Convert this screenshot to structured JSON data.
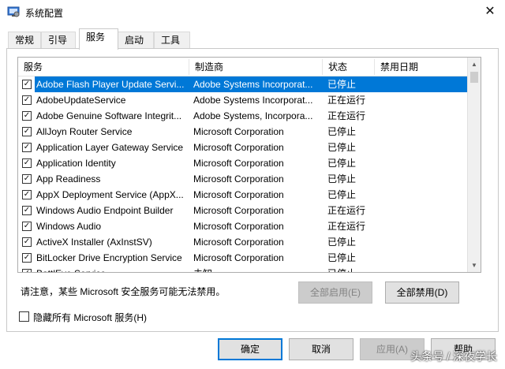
{
  "window": {
    "title": "系统配置"
  },
  "tabs": [
    {
      "label": "常规"
    },
    {
      "label": "引导"
    },
    {
      "label": "服务"
    },
    {
      "label": "启动"
    },
    {
      "label": "工具"
    }
  ],
  "list": {
    "columns": [
      "服务",
      "制造商",
      "状态",
      "禁用日期"
    ],
    "rows": [
      {
        "name": "Adobe Flash Player Update Servi...",
        "mfr": "Adobe Systems Incorporat...",
        "status": "已停止",
        "date": "",
        "checked": true,
        "selected": true
      },
      {
        "name": "AdobeUpdateService",
        "mfr": "Adobe Systems Incorporat...",
        "status": "正在运行",
        "date": "",
        "checked": true
      },
      {
        "name": "Adobe Genuine Software Integrit...",
        "mfr": "Adobe Systems, Incorpora...",
        "status": "正在运行",
        "date": "",
        "checked": true
      },
      {
        "name": "AllJoyn Router Service",
        "mfr": "Microsoft Corporation",
        "status": "已停止",
        "date": "",
        "checked": true
      },
      {
        "name": "Application Layer Gateway Service",
        "mfr": "Microsoft Corporation",
        "status": "已停止",
        "date": "",
        "checked": true
      },
      {
        "name": "Application Identity",
        "mfr": "Microsoft Corporation",
        "status": "已停止",
        "date": "",
        "checked": true
      },
      {
        "name": "App Readiness",
        "mfr": "Microsoft Corporation",
        "status": "已停止",
        "date": "",
        "checked": true
      },
      {
        "name": "AppX Deployment Service (AppX...",
        "mfr": "Microsoft Corporation",
        "status": "已停止",
        "date": "",
        "checked": true
      },
      {
        "name": "Windows Audio Endpoint Builder",
        "mfr": "Microsoft Corporation",
        "status": "正在运行",
        "date": "",
        "checked": true
      },
      {
        "name": "Windows Audio",
        "mfr": "Microsoft Corporation",
        "status": "正在运行",
        "date": "",
        "checked": true
      },
      {
        "name": "ActiveX Installer (AxInstSV)",
        "mfr": "Microsoft Corporation",
        "status": "已停止",
        "date": "",
        "checked": true
      },
      {
        "name": "BitLocker Drive Encryption Service",
        "mfr": "Microsoft Corporation",
        "status": "已停止",
        "date": "",
        "checked": true
      },
      {
        "name": "BattlEye Service",
        "mfr": "未知",
        "status": "已停止",
        "date": "",
        "checked": true
      }
    ]
  },
  "notice": "请注意，某些 Microsoft 安全服务可能无法禁用。",
  "buttons": {
    "enable_all": "全部启用(E)",
    "disable_all": "全部禁用(D)",
    "ok": "确定",
    "cancel": "取消",
    "apply": "应用(A)",
    "help": "帮助"
  },
  "hide_ms_label": "隐藏所有 Microsoft 服务(H)",
  "watermark": "头条号 / 深夜学长",
  "colors": {
    "selection": "#0078d7",
    "accent": "#0078d7"
  }
}
